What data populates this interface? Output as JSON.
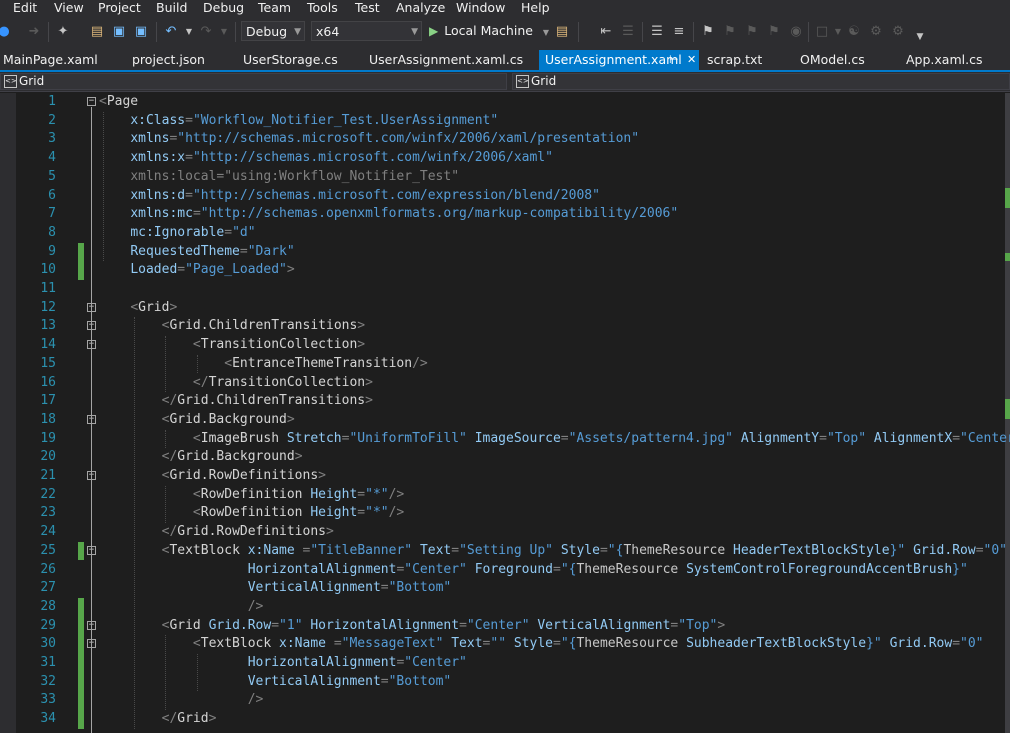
{
  "menu": [
    "Edit",
    "View",
    "Project",
    "Build",
    "Debug",
    "Team",
    "Tools",
    "Test",
    "Analyze",
    "Window",
    "Help"
  ],
  "toolbar": {
    "config": "Debug",
    "platform": "x64",
    "run_target": "Local Machine"
  },
  "tabs": [
    {
      "label": "MainPage.xaml",
      "active": false
    },
    {
      "label": "project.json",
      "active": false
    },
    {
      "label": "UserStorage.cs",
      "active": false
    },
    {
      "label": "UserAssignment.xaml.cs",
      "active": false
    },
    {
      "label": "UserAssignment.xaml",
      "active": true
    },
    {
      "label": "scrap.txt",
      "active": false
    },
    {
      "label": "OModel.cs",
      "active": false
    },
    {
      "label": "App.xaml.cs",
      "active": false
    }
  ],
  "navbar": {
    "left": "Grid",
    "right": "Grid"
  },
  "colors": {
    "accent": "#007acc",
    "change_bar": "#57a64a",
    "line_numbers": "#2b91af"
  },
  "lines": [
    {
      "n": "1",
      "fold": "minus",
      "chg": false,
      "tok": [
        [
          "p",
          "<"
        ],
        [
          "t",
          "Page"
        ]
      ]
    },
    {
      "n": "2",
      "chg": false,
      "tok": [
        [
          "t",
          "    "
        ],
        [
          "a",
          "x:Class"
        ],
        [
          "p",
          "="
        ],
        [
          "s",
          "\"Workflow_Notifier_Test.UserAssignment\""
        ]
      ]
    },
    {
      "n": "3",
      "chg": false,
      "tok": [
        [
          "t",
          "    "
        ],
        [
          "a",
          "xmlns"
        ],
        [
          "p",
          "="
        ],
        [
          "s",
          "\"http://schemas.microsoft.com/winfx/2006/xaml/presentation\""
        ]
      ]
    },
    {
      "n": "4",
      "chg": false,
      "tok": [
        [
          "t",
          "    "
        ],
        [
          "a",
          "xmlns:x"
        ],
        [
          "p",
          "="
        ],
        [
          "s",
          "\"http://schemas.microsoft.com/winfx/2006/xaml\""
        ]
      ]
    },
    {
      "n": "5",
      "chg": false,
      "tok": [
        [
          "t",
          "    "
        ],
        [
          "p",
          "xmlns:local=\"using:Workflow_Notifier_Test\""
        ]
      ]
    },
    {
      "n": "6",
      "chg": false,
      "tok": [
        [
          "t",
          "    "
        ],
        [
          "a",
          "xmlns:d"
        ],
        [
          "p",
          "="
        ],
        [
          "s",
          "\"http://schemas.microsoft.com/expression/blend/2008\""
        ]
      ]
    },
    {
      "n": "7",
      "chg": false,
      "tok": [
        [
          "t",
          "    "
        ],
        [
          "a",
          "xmlns:mc"
        ],
        [
          "p",
          "="
        ],
        [
          "s",
          "\"http://schemas.openxmlformats.org/markup-compatibility/2006\""
        ]
      ]
    },
    {
      "n": "8",
      "chg": false,
      "tok": [
        [
          "t",
          "    "
        ],
        [
          "a",
          "mc:Ignorable"
        ],
        [
          "p",
          "="
        ],
        [
          "s",
          "\"d\""
        ]
      ]
    },
    {
      "n": "9",
      "chg": true,
      "tok": [
        [
          "t",
          "    "
        ],
        [
          "a",
          "RequestedTheme"
        ],
        [
          "p",
          "="
        ],
        [
          "s",
          "\"Dark\""
        ]
      ]
    },
    {
      "n": "10",
      "chg": true,
      "tok": [
        [
          "t",
          "    "
        ],
        [
          "a",
          "Loaded"
        ],
        [
          "p",
          "="
        ],
        [
          "s",
          "\"Page_Loaded\""
        ],
        [
          "p",
          ">"
        ]
      ]
    },
    {
      "n": "11",
      "chg": false,
      "tok": []
    },
    {
      "n": "12",
      "fold": "minus",
      "chg": false,
      "tok": [
        [
          "t",
          "    "
        ],
        [
          "p",
          "<"
        ],
        [
          "t",
          "Grid"
        ],
        [
          "p",
          ">"
        ]
      ]
    },
    {
      "n": "13",
      "fold": "minus",
      "chg": false,
      "tok": [
        [
          "t",
          "        "
        ],
        [
          "p",
          "<"
        ],
        [
          "t",
          "Grid.ChildrenTransitions"
        ],
        [
          "p",
          ">"
        ]
      ]
    },
    {
      "n": "14",
      "fold": "minus",
      "chg": false,
      "tok": [
        [
          "t",
          "            "
        ],
        [
          "p",
          "<"
        ],
        [
          "t",
          "TransitionCollection"
        ],
        [
          "p",
          ">"
        ]
      ]
    },
    {
      "n": "15",
      "chg": false,
      "tok": [
        [
          "t",
          "                "
        ],
        [
          "p",
          "<"
        ],
        [
          "t",
          "EntranceThemeTransition"
        ],
        [
          "p",
          "/>"
        ]
      ]
    },
    {
      "n": "16",
      "chg": false,
      "tok": [
        [
          "t",
          "            "
        ],
        [
          "p",
          "</"
        ],
        [
          "t",
          "TransitionCollection"
        ],
        [
          "p",
          ">"
        ]
      ]
    },
    {
      "n": "17",
      "chg": false,
      "tok": [
        [
          "t",
          "        "
        ],
        [
          "p",
          "</"
        ],
        [
          "t",
          "Grid.ChildrenTransitions"
        ],
        [
          "p",
          ">"
        ]
      ]
    },
    {
      "n": "18",
      "fold": "minus",
      "chg": false,
      "tok": [
        [
          "t",
          "        "
        ],
        [
          "p",
          "<"
        ],
        [
          "t",
          "Grid.Background"
        ],
        [
          "p",
          ">"
        ]
      ]
    },
    {
      "n": "19",
      "chg": false,
      "tok": [
        [
          "t",
          "            "
        ],
        [
          "p",
          "<"
        ],
        [
          "t",
          "ImageBrush "
        ],
        [
          "a",
          "Stretch"
        ],
        [
          "p",
          "="
        ],
        [
          "s",
          "\"UniformToFill\""
        ],
        [
          "t",
          " "
        ],
        [
          "a",
          "ImageSource"
        ],
        [
          "p",
          "="
        ],
        [
          "s",
          "\"Assets/pattern4.jpg\""
        ],
        [
          "t",
          " "
        ],
        [
          "a",
          "AlignmentY"
        ],
        [
          "p",
          "="
        ],
        [
          "s",
          "\"Top\""
        ],
        [
          "t",
          " "
        ],
        [
          "a",
          "AlignmentX"
        ],
        [
          "p",
          "="
        ],
        [
          "s",
          "\"Center\""
        ]
      ]
    },
    {
      "n": "20",
      "chg": false,
      "tok": [
        [
          "t",
          "        "
        ],
        [
          "p",
          "</"
        ],
        [
          "t",
          "Grid.Background"
        ],
        [
          "p",
          ">"
        ]
      ]
    },
    {
      "n": "21",
      "fold": "minus",
      "chg": false,
      "tok": [
        [
          "t",
          "        "
        ],
        [
          "p",
          "<"
        ],
        [
          "t",
          "Grid.RowDefinitions"
        ],
        [
          "p",
          ">"
        ]
      ]
    },
    {
      "n": "22",
      "chg": false,
      "tok": [
        [
          "t",
          "            "
        ],
        [
          "p",
          "<"
        ],
        [
          "t",
          "RowDefinition "
        ],
        [
          "a",
          "Height"
        ],
        [
          "p",
          "="
        ],
        [
          "s",
          "\"*\""
        ],
        [
          "p",
          "/>"
        ]
      ]
    },
    {
      "n": "23",
      "chg": false,
      "tok": [
        [
          "t",
          "            "
        ],
        [
          "p",
          "<"
        ],
        [
          "t",
          "RowDefinition "
        ],
        [
          "a",
          "Height"
        ],
        [
          "p",
          "="
        ],
        [
          "s",
          "\"*\""
        ],
        [
          "p",
          "/>"
        ]
      ]
    },
    {
      "n": "24",
      "chg": false,
      "tok": [
        [
          "t",
          "        "
        ],
        [
          "p",
          "</"
        ],
        [
          "t",
          "Grid.RowDefinitions"
        ],
        [
          "p",
          ">"
        ]
      ]
    },
    {
      "n": "25",
      "fold": "minus",
      "chg": true,
      "tok": [
        [
          "t",
          "        "
        ],
        [
          "p",
          "<"
        ],
        [
          "t",
          "TextBlock "
        ],
        [
          "a",
          "x:Name"
        ],
        [
          "t",
          " "
        ],
        [
          "p",
          "="
        ],
        [
          "s",
          "\"TitleBanner\""
        ],
        [
          "t",
          " "
        ],
        [
          "a",
          "Text"
        ],
        [
          "p",
          "="
        ],
        [
          "s",
          "\"Setting Up\""
        ],
        [
          "t",
          " "
        ],
        [
          "a",
          "Style"
        ],
        [
          "p",
          "="
        ],
        [
          "s",
          "\"{"
        ],
        [
          "v",
          "ThemeResource "
        ],
        [
          "a",
          "HeaderTextBlockStyle"
        ],
        [
          "s",
          "}\""
        ],
        [
          "t",
          " "
        ],
        [
          "a",
          "Grid.Row"
        ],
        [
          "p",
          "="
        ],
        [
          "s",
          "\"0\""
        ]
      ]
    },
    {
      "n": "26",
      "chg": false,
      "tok": [
        [
          "t",
          "                   "
        ],
        [
          "a",
          "HorizontalAlignment"
        ],
        [
          "p",
          "="
        ],
        [
          "s",
          "\"Center\""
        ],
        [
          "t",
          " "
        ],
        [
          "a",
          "Foreground"
        ],
        [
          "p",
          "="
        ],
        [
          "s",
          "\"{"
        ],
        [
          "v",
          "ThemeResource "
        ],
        [
          "a",
          "SystemControlForegroundAccentBrush"
        ],
        [
          "s",
          "}\""
        ]
      ]
    },
    {
      "n": "27",
      "chg": false,
      "tok": [
        [
          "t",
          "                   "
        ],
        [
          "a",
          "VerticalAlignment"
        ],
        [
          "p",
          "="
        ],
        [
          "s",
          "\"Bottom\""
        ]
      ]
    },
    {
      "n": "28",
      "chg": true,
      "tok": [
        [
          "t",
          "                   "
        ],
        [
          "p",
          "/>"
        ]
      ]
    },
    {
      "n": "29",
      "fold": "minus",
      "chg": true,
      "tok": [
        [
          "t",
          "        "
        ],
        [
          "p",
          "<"
        ],
        [
          "t",
          "Grid "
        ],
        [
          "a",
          "Grid.Row"
        ],
        [
          "p",
          "="
        ],
        [
          "s",
          "\"1\""
        ],
        [
          "t",
          " "
        ],
        [
          "a",
          "HorizontalAlignment"
        ],
        [
          "p",
          "="
        ],
        [
          "s",
          "\"Center\""
        ],
        [
          "t",
          " "
        ],
        [
          "a",
          "VerticalAlignment"
        ],
        [
          "p",
          "="
        ],
        [
          "s",
          "\"Top\""
        ],
        [
          "p",
          ">"
        ]
      ]
    },
    {
      "n": "30",
      "fold": "minus",
      "chg": true,
      "tok": [
        [
          "t",
          "            "
        ],
        [
          "p",
          "<"
        ],
        [
          "t",
          "TextBlock "
        ],
        [
          "a",
          "x:Name"
        ],
        [
          "t",
          " "
        ],
        [
          "p",
          "="
        ],
        [
          "s",
          "\"MessageText\""
        ],
        [
          "t",
          " "
        ],
        [
          "a",
          "Text"
        ],
        [
          "p",
          "="
        ],
        [
          "s",
          "\"\""
        ],
        [
          "t",
          " "
        ],
        [
          "a",
          "Style"
        ],
        [
          "p",
          "="
        ],
        [
          "s",
          "\"{"
        ],
        [
          "v",
          "ThemeResource "
        ],
        [
          "a",
          "SubheaderTextBlockStyle"
        ],
        [
          "s",
          "}\""
        ],
        [
          "t",
          " "
        ],
        [
          "a",
          "Grid.Row"
        ],
        [
          "p",
          "="
        ],
        [
          "s",
          "\"0\""
        ]
      ]
    },
    {
      "n": "31",
      "chg": true,
      "tok": [
        [
          "t",
          "                   "
        ],
        [
          "a",
          "HorizontalAlignment"
        ],
        [
          "p",
          "="
        ],
        [
          "s",
          "\"Center\""
        ]
      ]
    },
    {
      "n": "32",
      "chg": true,
      "tok": [
        [
          "t",
          "                   "
        ],
        [
          "a",
          "VerticalAlignment"
        ],
        [
          "p",
          "="
        ],
        [
          "s",
          "\"Bottom\""
        ]
      ]
    },
    {
      "n": "33",
      "chg": true,
      "tok": [
        [
          "t",
          "                   "
        ],
        [
          "p",
          "/>"
        ]
      ]
    },
    {
      "n": "34",
      "chg": true,
      "tok": [
        [
          "t",
          "        "
        ],
        [
          "p",
          "</"
        ],
        [
          "t",
          "Grid"
        ],
        [
          "p",
          ">"
        ]
      ]
    }
  ]
}
